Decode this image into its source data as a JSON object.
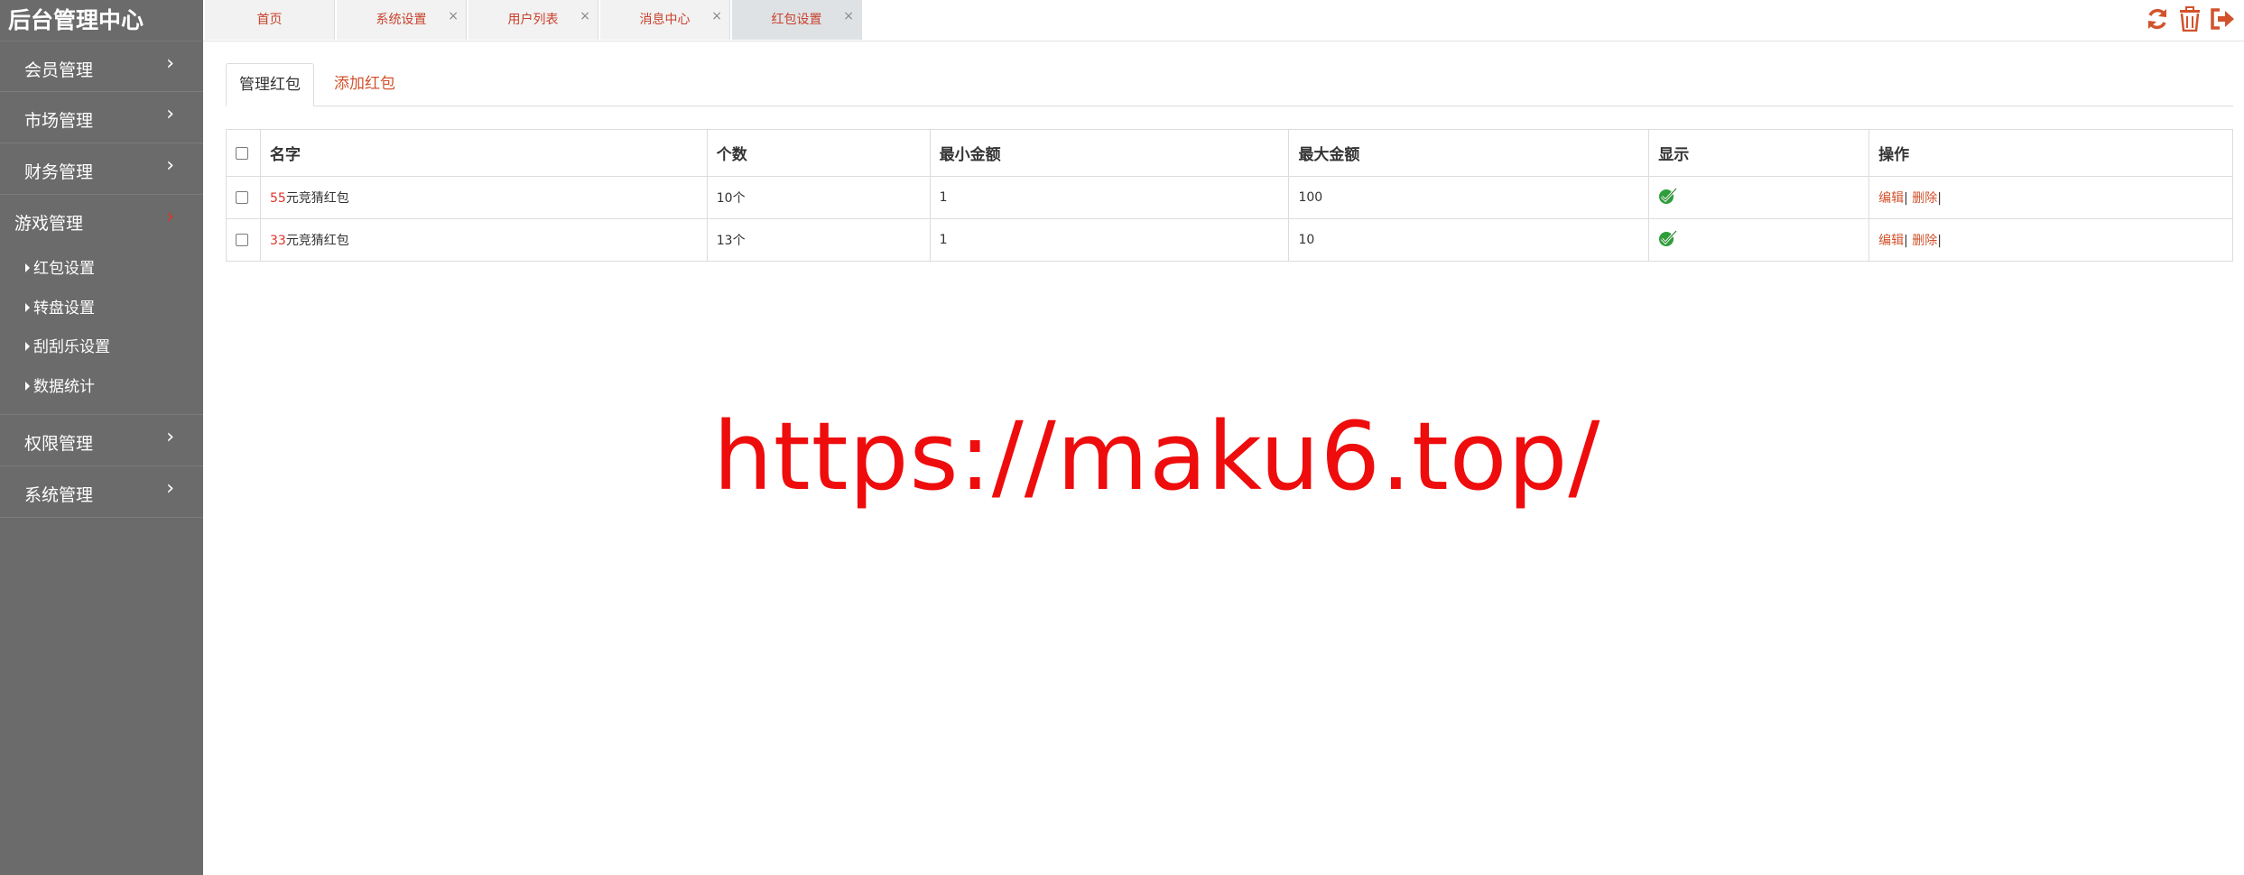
{
  "app": {
    "title": "后台管理中心"
  },
  "sidebar": {
    "items": [
      {
        "label": "会员管理"
      },
      {
        "label": "市场管理"
      },
      {
        "label": "财务管理"
      },
      {
        "label": "游戏管理",
        "expanded": true,
        "children": [
          {
            "label": "红包设置"
          },
          {
            "label": "转盘设置"
          },
          {
            "label": "刮刮乐设置"
          },
          {
            "label": "数据统计"
          }
        ]
      },
      {
        "label": "权限管理"
      },
      {
        "label": "系统管理"
      }
    ]
  },
  "tabs": [
    {
      "label": "首页",
      "closable": false
    },
    {
      "label": "系统设置",
      "closable": true
    },
    {
      "label": "用户列表",
      "closable": true
    },
    {
      "label": "消息中心",
      "closable": true
    },
    {
      "label": "红包设置",
      "closable": true,
      "active": true
    }
  ],
  "tab_close_glyph": "×",
  "toolbar": {
    "icons": [
      "refresh-icon",
      "trash-icon",
      "logout-icon"
    ],
    "accent": "#d2522c"
  },
  "subtabs": {
    "manage": "管理红包",
    "add": "添加红包"
  },
  "table": {
    "headers": [
      "名字",
      "个数",
      "最小金额",
      "最大金额",
      "显示",
      "操作"
    ],
    "rows": [
      {
        "name_num": "55",
        "name_rest": "元竞猜红包",
        "count": "10个",
        "min": "1",
        "max": "100",
        "visible": true,
        "edit": "编辑",
        "delete": "删除"
      },
      {
        "name_num": "33",
        "name_rest": "元竞猜红包",
        "count": "13个",
        "min": "1",
        "max": "10",
        "visible": true,
        "edit": "编辑",
        "delete": "删除"
      }
    ],
    "separator": "|"
  },
  "watermark": "https://maku6.top/"
}
